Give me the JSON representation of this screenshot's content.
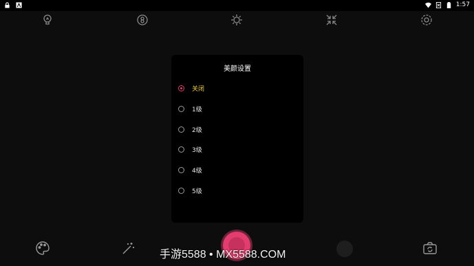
{
  "status_bar": {
    "time": "1:57",
    "icons": [
      "lock-icon",
      "notification-icon",
      "wifi-icon",
      "no-sim-icon",
      "battery-icon"
    ]
  },
  "top_toolbar": {
    "icons": [
      "flash-icon",
      "hdr-icon",
      "brightness-icon",
      "collapse-icon",
      "settings-icon"
    ]
  },
  "dialog": {
    "title": "美颜设置",
    "options": [
      {
        "label": "关闭",
        "selected": true
      },
      {
        "label": "1级",
        "selected": false
      },
      {
        "label": "2级",
        "selected": false
      },
      {
        "label": "3级",
        "selected": false
      },
      {
        "label": "4级",
        "selected": false
      },
      {
        "label": "5级",
        "selected": false
      }
    ]
  },
  "bottom_toolbar": {
    "icons": [
      "palette-icon",
      "magic-wand-icon",
      "shutter-button",
      "gallery-thumbnail",
      "switch-camera-icon"
    ]
  },
  "watermark": "手游5588 • MX5588.COM",
  "colors": {
    "accent": "#e33c6e",
    "selected_label": "#f2d03a",
    "background": "#0d0d0d",
    "dialog_bg": "#000000"
  }
}
